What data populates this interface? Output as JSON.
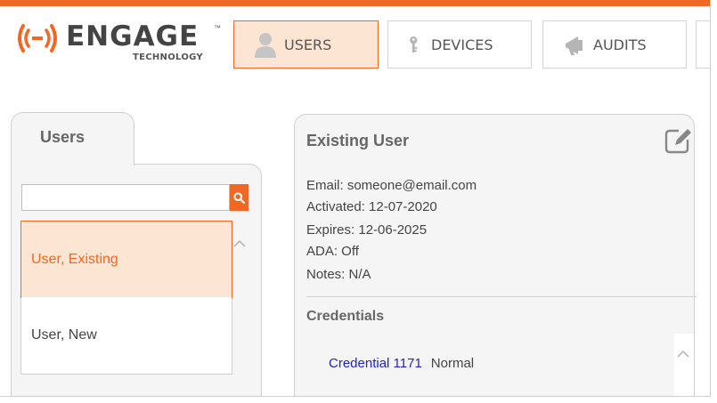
{
  "colors": {
    "accent": "#f26722",
    "link": "#2222cc"
  },
  "logo": {
    "word": "ENGAGE",
    "tm": "™",
    "sub": "TECHNOLOGY"
  },
  "nav": [
    {
      "label": "USERS",
      "icon": "user-icon",
      "active": true
    },
    {
      "label": "DEVICES",
      "icon": "key-icon",
      "active": false
    },
    {
      "label": "AUDITS",
      "icon": "megaphone-icon",
      "active": false
    }
  ],
  "left_panel": {
    "tab_label": "Users",
    "search": {
      "value": "",
      "placeholder": ""
    },
    "users": [
      {
        "label": "User, Existing",
        "selected": true
      },
      {
        "label": "User, New",
        "selected": false
      }
    ]
  },
  "detail": {
    "title": "Existing User",
    "lines": [
      "Email: someone@email.com",
      "Activated: 12-07-2020",
      "Expires: 12-06-2025",
      "ADA: Off",
      "Notes: N/A"
    ],
    "credentials_heading": "Credentials",
    "credentials": [
      {
        "name": "Credential 1171",
        "status": "Normal"
      }
    ]
  }
}
